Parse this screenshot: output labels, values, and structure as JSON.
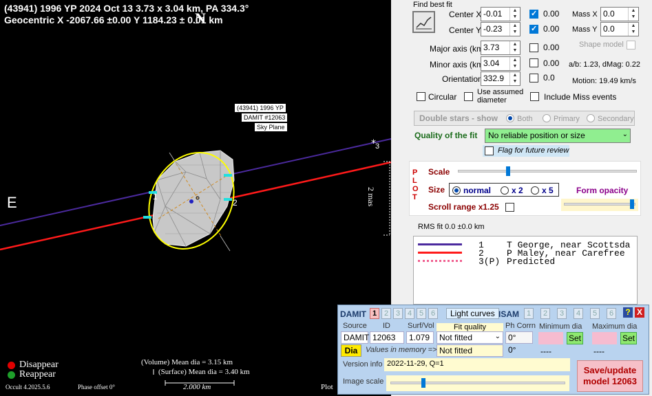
{
  "plot": {
    "title_line1": "(43941) 1996 YP  2024 Oct 13  3.73 x 3.04 km, PA 334.3°",
    "title_line2": "Geocentric  X  -2067.66 ±0.00  Y 1184.23 ± 0.01 km",
    "north": "N",
    "east": "E",
    "label_asteroid": "(43941) 1996 YP",
    "label_damit": "DAMIT #12063",
    "label_skyplane": "Sky Plane",
    "chord1_label": "1",
    "chord2_label": "2",
    "chord3_label": "3",
    "scale_mas": "2 mas",
    "legend_disappear": "Disappear",
    "legend_reappear": "Reappear",
    "vol_dia": "(Volume) Mean dia = 3.15 km",
    "surf_dia": "(Surface) Mean dia = 3.40 km",
    "scale_km": "2.000 km",
    "version": "Occult 4.2025.5.6",
    "phase": "Phase offset 0°",
    "plot_label": "Plot",
    "colors": {
      "disappear": "#e00000",
      "reappear": "#1e9e2a",
      "chord1": "#4b2a9e",
      "chord2": "#ff1a1a",
      "ellipse": "#ffff00"
    }
  },
  "fit": {
    "title": "Find best fit",
    "fit_icon": "chart-fit-icon",
    "center_x_label": "Center X",
    "center_x": "-0.01",
    "center_x_unc": "0.00",
    "center_y_label": "Center Y",
    "center_y": "-0.23",
    "center_y_unc": "0.00",
    "mass_x_label": "Mass X",
    "mass_x": "0.0",
    "mass_y_label": "Mass Y",
    "mass_y": "0.0",
    "shape_model_label": "Shape model",
    "major_label": "Major axis (km)",
    "major": "3.73",
    "major_unc": "0.00",
    "minor_label": "Minor axis (km)",
    "minor": "3.04",
    "minor_unc": "0.00",
    "orient_label": "Orientation",
    "orient": "332.9",
    "orient_unc": "0.0",
    "ab_text": "a/b: 1.23, dMag: 0.22",
    "motion_text": "Motion: 19.49 km/s",
    "circular_label": "Circular",
    "assumed_label1": "Use assumed",
    "assumed_label2": "diameter",
    "miss_label": "Include Miss events",
    "double_label": "Double stars - show",
    "both_label": "Both",
    "primary_label": "Primary",
    "secondary_label": "Secondary",
    "quality_label": "Quality of the fit",
    "quality_value": "No reliable position or size",
    "flag_label": "Flag for future review"
  },
  "plotopts": {
    "plot_vertical": "PLOT",
    "scale_label": "Scale",
    "size_label": "Size",
    "normal_label": "normal",
    "x2_label": "x 2",
    "x5_label": "x 5",
    "opacity_label": "Form opacity",
    "scroll_label": "Scroll range x1.25",
    "scale_level": 0.28,
    "opacity_level": 0.95
  },
  "rms": "RMS fit 0.0 ±0.0 km",
  "legend": [
    {
      "num": "1",
      "text": "T George, near Scottsda",
      "color": "#4b2a9e",
      "style": "solid"
    },
    {
      "num": "2",
      "text": "P Maley, near Carefree",
      "color": "#ff1a1a",
      "style": "solid"
    },
    {
      "num": "3(P)",
      "text": "Predicted",
      "color": "#f06090",
      "style": "dotted"
    }
  ],
  "damit": {
    "damit_label": "DAMIT",
    "tabs": [
      "1",
      "2",
      "3",
      "4",
      "5",
      "6"
    ],
    "light_curves": "Light curves",
    "isam_label": "ISAM",
    "isam_tabs": [
      "1",
      "2",
      "3",
      "4",
      "5",
      "6"
    ],
    "help": "?",
    "close": "X",
    "source_h": "Source",
    "id_h": "ID",
    "sv_h": "Surf/Vol",
    "fitq_h": "Fit quality",
    "phcorr_h": "Ph Corrn",
    "mindia_h": "Minimum dia",
    "maxdia_h": "Maximum dia",
    "source": "DAMIT",
    "id": "12063",
    "sv": "1.079",
    "fitq": "Not fitted",
    "phcorr": "0°",
    "set1": "Set",
    "set2": "Set",
    "dia_btn": "Dia",
    "values_mem": "Values in memory =>",
    "fitq2": "Not fitted",
    "phcorr2": "0°",
    "min2": "----",
    "max2": "----",
    "version_label": "Version info",
    "version_value": "2022-11-29, Q=1",
    "image_scale_label": "Image scale",
    "save_btn_l1": "Save/update",
    "save_btn_l2": "model  12063",
    "image_scale_level": 0.19
  }
}
